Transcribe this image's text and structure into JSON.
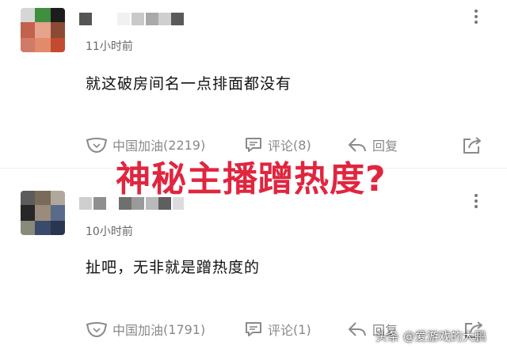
{
  "comments": [
    {
      "time": "11小时前",
      "content": "就这破房间名一点排面都没有",
      "like_label": "中国加油",
      "like_count": "(2219)",
      "comment_label": "评论",
      "comment_count": "(8)",
      "reply_label": "回复"
    },
    {
      "time": "10小时前",
      "content": "扯吧，无非就是蹭热度的",
      "like_label": "中国加油",
      "like_count": "(1791)",
      "comment_label": "评论",
      "comment_count": "(1)",
      "reply_label": "回复"
    }
  ],
  "overlay": {
    "headline": "神秘主播蹭热度?"
  },
  "watermark": {
    "text": "头条 @爱游戏的大鹏"
  },
  "colors": {
    "headline": "#e0263f",
    "meta_text": "#888888",
    "content_text": "#111111"
  },
  "icons": {
    "like": "mask-like-icon",
    "comment": "speech-bubble-icon",
    "reply": "reply-arrow-icon",
    "share": "share-icon",
    "more": "more-vertical-icon"
  }
}
